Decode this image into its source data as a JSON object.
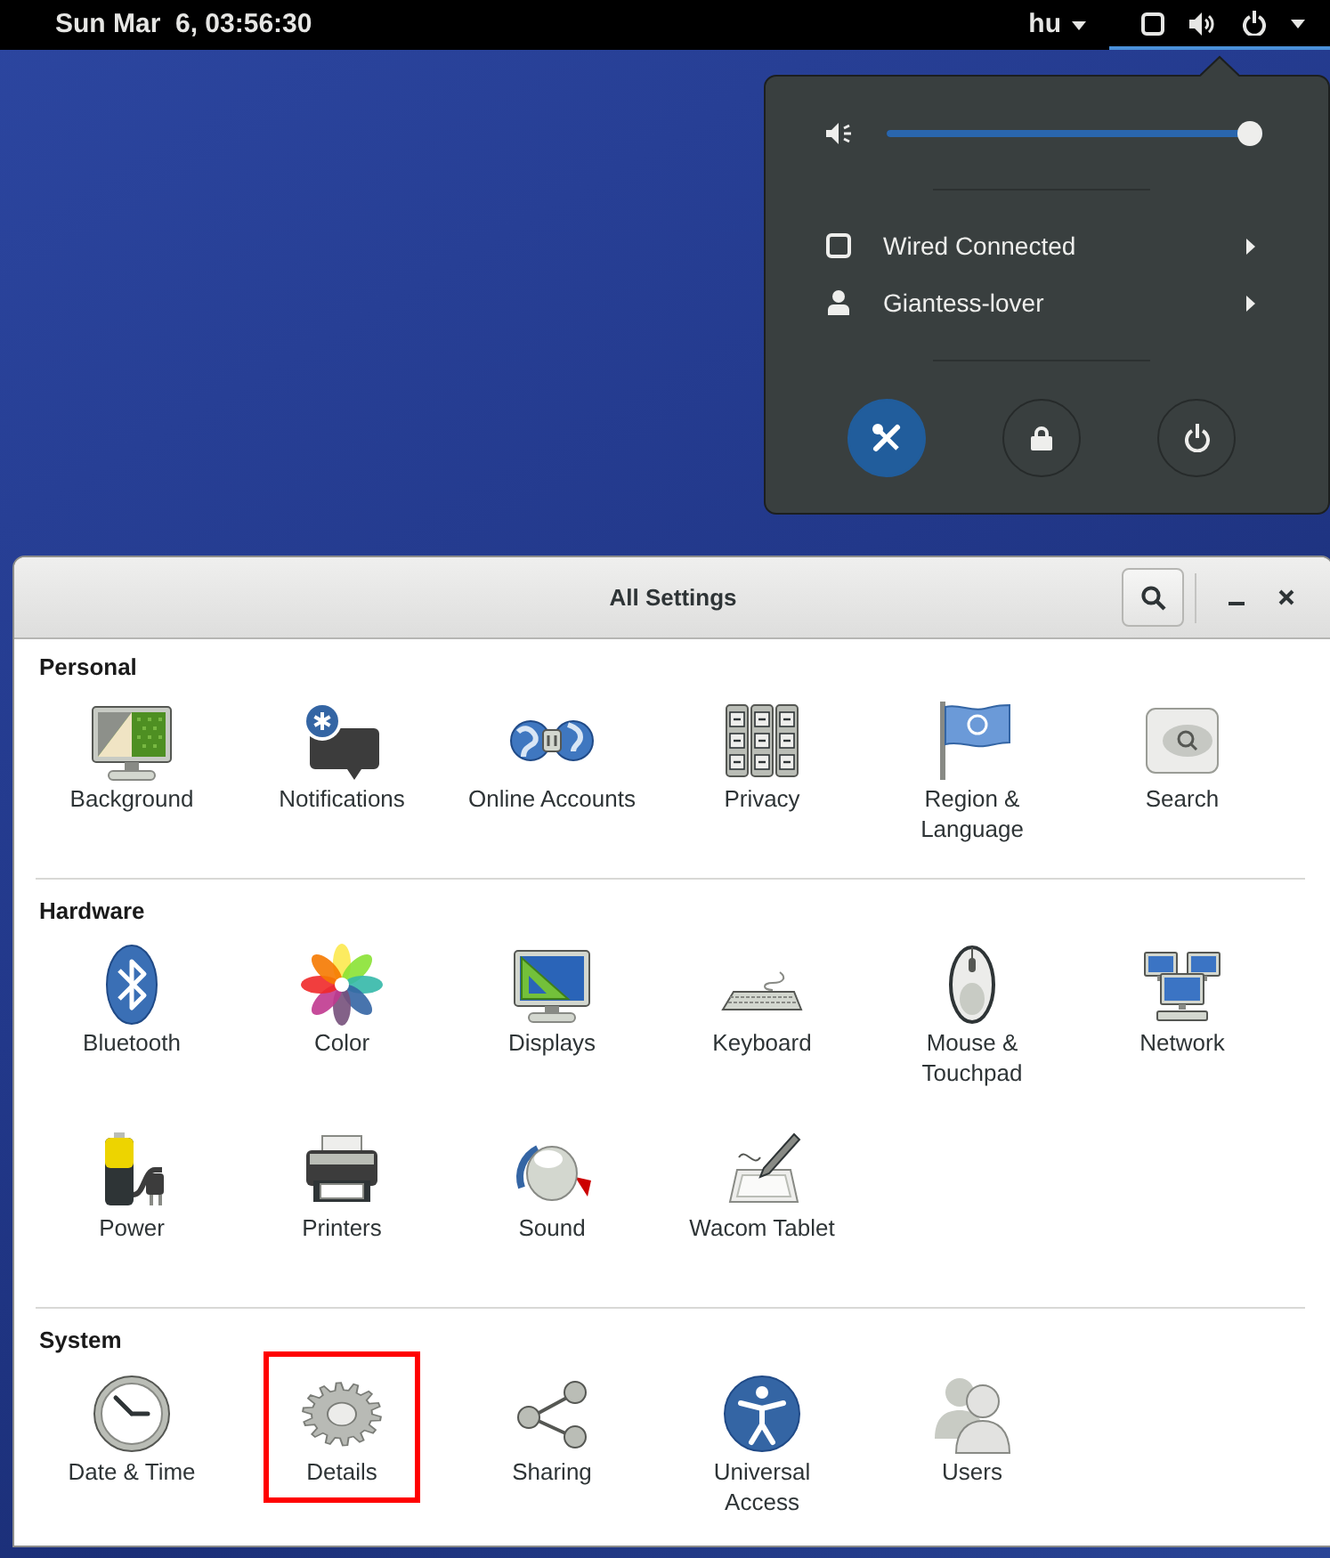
{
  "top_bar": {
    "clock": "Sun Mar  6, 03:56:30",
    "input_source": "hu",
    "system_menu_open": true
  },
  "system_menu": {
    "volume": {
      "level": 1.0
    },
    "items": [
      {
        "label": "Wired Connected"
      },
      {
        "label": "Giantess-lover"
      }
    ],
    "actions": [
      {
        "selected": true
      },
      {
        "selected": false
      },
      {
        "selected": false
      }
    ]
  },
  "settings_window": {
    "title": "All Settings",
    "sections": [
      {
        "title": "Personal",
        "items": [
          {
            "label": "Background",
            "highlighted": false
          },
          {
            "label": "Notifications",
            "highlighted": false
          },
          {
            "label": "Online Accounts",
            "highlighted": false
          },
          {
            "label": "Privacy",
            "highlighted": false
          },
          {
            "label": "Region & Language",
            "highlighted": false
          },
          {
            "label": "Search",
            "highlighted": false
          }
        ]
      },
      {
        "title": "Hardware",
        "items": [
          {
            "label": "Bluetooth",
            "highlighted": false
          },
          {
            "label": "Color",
            "highlighted": false
          },
          {
            "label": "Displays",
            "highlighted": false
          },
          {
            "label": "Keyboard",
            "highlighted": false
          },
          {
            "label": "Mouse & Touchpad",
            "highlighted": false
          },
          {
            "label": "Network",
            "highlighted": false
          },
          {
            "label": "Power",
            "highlighted": false
          },
          {
            "label": "Printers",
            "highlighted": false
          },
          {
            "label": "Sound",
            "highlighted": false
          },
          {
            "label": "Wacom Tablet",
            "highlighted": false
          }
        ]
      },
      {
        "title": "System",
        "items": [
          {
            "label": "Date & Time",
            "highlighted": false
          },
          {
            "label": "Details",
            "highlighted": true
          },
          {
            "label": "Sharing",
            "highlighted": false
          },
          {
            "label": "Universal Access",
            "highlighted": false
          },
          {
            "label": "Users",
            "highlighted": false
          }
        ]
      }
    ]
  }
}
